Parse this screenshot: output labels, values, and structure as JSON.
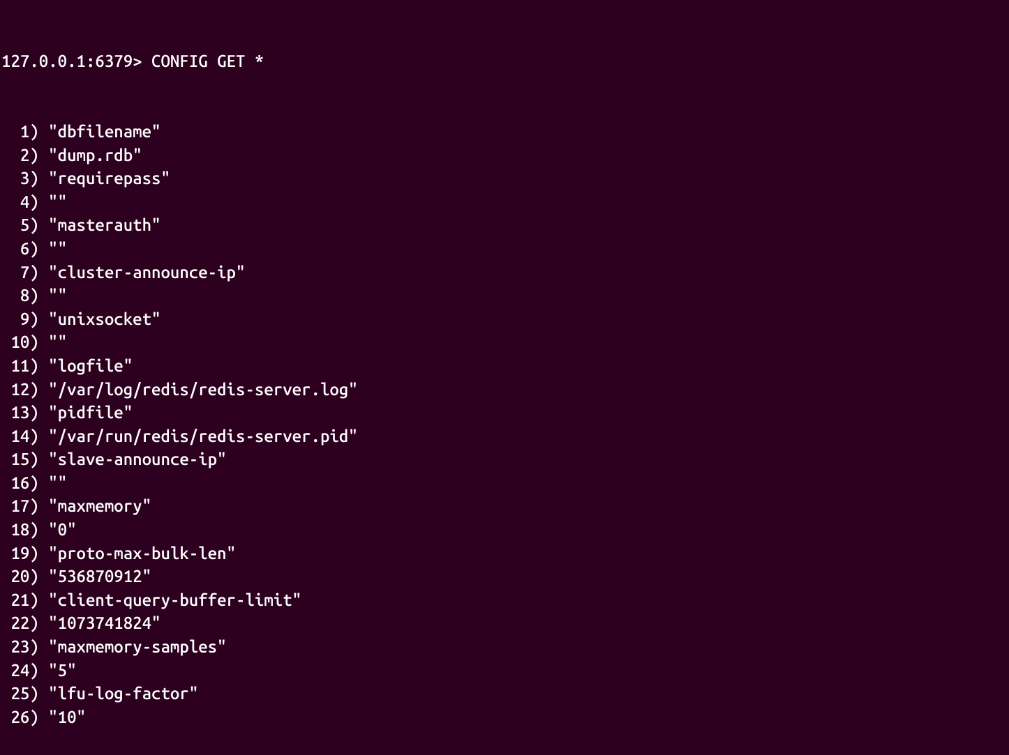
{
  "prompt": "127.0.0.1:6379> ",
  "command": "CONFIG GET *",
  "output": [
    "\"dbfilename\"",
    "\"dump.rdb\"",
    "\"requirepass\"",
    "\"\"",
    "\"masterauth\"",
    "\"\"",
    "\"cluster-announce-ip\"",
    "\"\"",
    "\"unixsocket\"",
    "\"\"",
    "\"logfile\"",
    "\"/var/log/redis/redis-server.log\"",
    "\"pidfile\"",
    "\"/var/run/redis/redis-server.pid\"",
    "\"slave-announce-ip\"",
    "\"\"",
    "\"maxmemory\"",
    "\"0\"",
    "\"proto-max-bulk-len\"",
    "\"536870912\"",
    "\"client-query-buffer-limit\"",
    "\"1073741824\"",
    "\"maxmemory-samples\"",
    "\"5\"",
    "\"lfu-log-factor\"",
    "\"10\""
  ]
}
